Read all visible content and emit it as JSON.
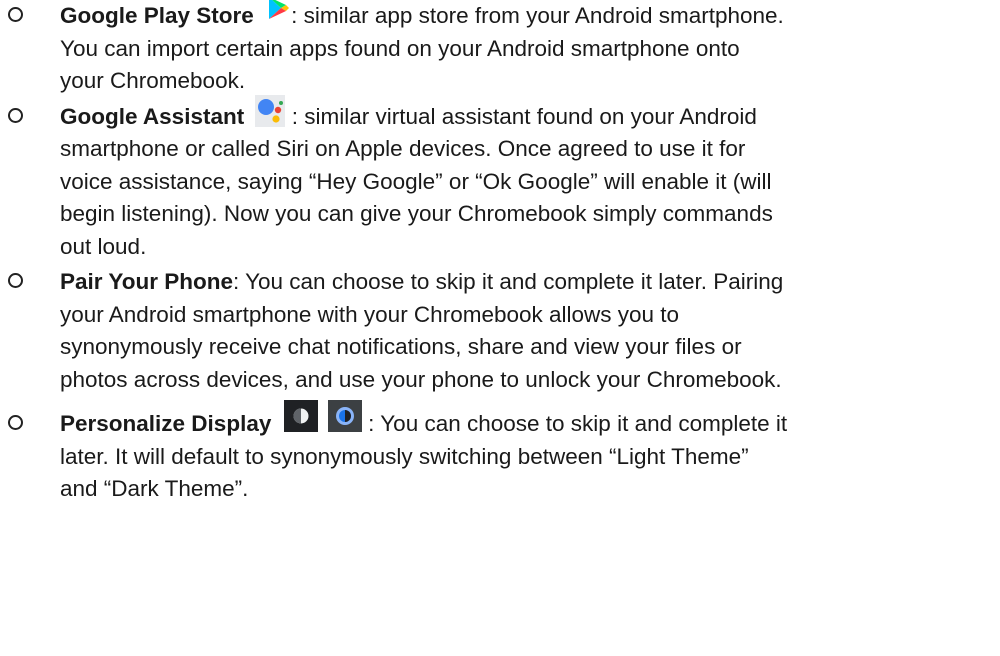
{
  "items": [
    {
      "term": "Google Play Store",
      "lines": [
        ": similar app store from your Android smartphone.",
        "You can import certain apps found on your Android smartphone onto",
        "your Chromebook."
      ]
    },
    {
      "term": "Google Assistant",
      "lines": [
        " : similar virtual assistant found on your Android",
        "smartphone or called Siri on Apple devices. Once agreed to use it for",
        "voice assistance, saying “Hey Google” or “Ok Google” will enable it (will",
        "begin listening). Now you can give your Chromebook simply commands",
        "out loud."
      ]
    },
    {
      "term": "Pair Your Phone",
      "lines": [
        ": You can choose to skip it and complete it later. Pairing",
        "your Android smartphone with your Chromebook allows you to",
        "synonymously receive chat notifications, share and view your files or",
        "photos across devices, and use your phone to unlock your Chromebook."
      ]
    },
    {
      "term": "Personalize Display",
      "lines": [
        " : You can choose to skip it and complete it",
        "later. It will default to synonymously switching between “Light Theme”",
        "and “Dark Theme”."
      ]
    }
  ],
  "icons": {
    "play_store": "google-play-store-icon",
    "assistant": "google-assistant-icon",
    "display_theme_1": "display-theme-icon",
    "display_theme_2": "display-theme-icon"
  }
}
